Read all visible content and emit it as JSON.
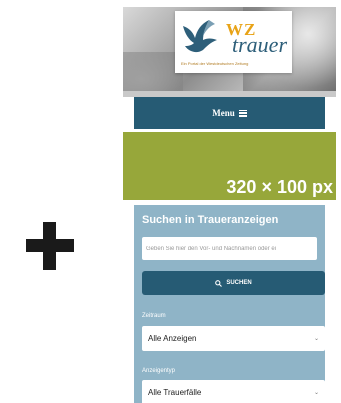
{
  "logo": {
    "brand_top": "WZ",
    "brand_main": "trauer",
    "tagline": "Ein Portal der Westdeutschen Zeitung"
  },
  "menu": {
    "label": "Menu",
    "icon": "hamburger-icon"
  },
  "ad": {
    "size_label": "320 × 100 px",
    "color": "#97a73a"
  },
  "search": {
    "title": "Suchen in Traueranzeigen",
    "placeholder": "Geben Sie hier den Vor- und Nachnamen oder ei",
    "button_label": "SUCHEN",
    "button_icon": "search-icon"
  },
  "filters": {
    "zeitraum_label": "Zeitraum",
    "zeitraum_value": "Alle Anzeigen",
    "anzeigentyp_label": "Anzeigentyp",
    "anzeigentyp_value": "Alle Trauerfälle"
  },
  "colors": {
    "primary": "#265b74",
    "panel": "#8fb4c7",
    "logo_orange": "#e8a317",
    "logo_blue": "#2e5f7a"
  },
  "plus_icon": "plus-icon"
}
